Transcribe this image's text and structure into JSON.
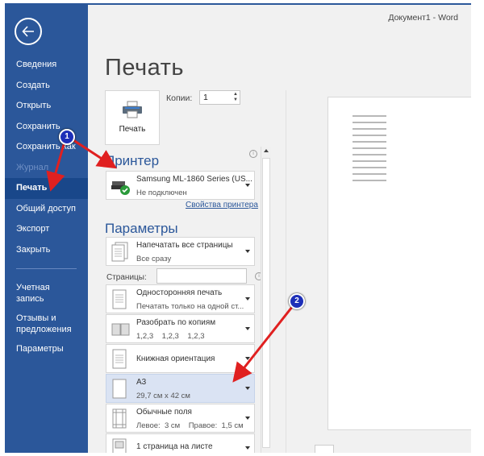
{
  "window": {
    "title": "Документ1  -  Word"
  },
  "colors": {
    "accent": "#2b579a",
    "sidebar_active": "#19478a",
    "selected_row": "#dae3f3",
    "annotation_arrow": "#e02020",
    "annotation_badge": "#1d2fb8"
  },
  "sidebar": {
    "back_icon": "arrow-left-circle-icon",
    "items": [
      {
        "label": "Сведения",
        "state": "normal"
      },
      {
        "label": "Создать",
        "state": "normal"
      },
      {
        "label": "Открыть",
        "state": "normal"
      },
      {
        "label": "Сохранить",
        "state": "normal"
      },
      {
        "label": "Сохранить как",
        "state": "normal"
      },
      {
        "label": "Журнал",
        "state": "disabled"
      },
      {
        "label": "Печать",
        "state": "active"
      },
      {
        "label": "Общий доступ",
        "state": "normal"
      },
      {
        "label": "Экспорт",
        "state": "normal"
      },
      {
        "label": "Закрыть",
        "state": "normal"
      }
    ],
    "bottom_items": [
      {
        "label": "Учетная запись"
      },
      {
        "label": "Отзывы и предложения"
      },
      {
        "label": "Параметры"
      }
    ]
  },
  "main": {
    "title": "Печать",
    "print_button": {
      "label": "Печать",
      "icon": "printer-icon"
    },
    "copies": {
      "label": "Копии:",
      "value": "1"
    },
    "printer": {
      "section_title": "Принтер",
      "name": "Samsung ML-1860 Series (US...",
      "status": "Не подключен",
      "properties_link": "Свойства принтера"
    },
    "settings": {
      "section_title": "Параметры",
      "pages_label": "Страницы:",
      "pages_value": "",
      "options": [
        {
          "line1": "Напечатать все страницы",
          "line2": "Все сразу",
          "icon": "pages-icon"
        },
        {
          "line1": "Односторонняя печать",
          "line2": "Печатать только на одной ст...",
          "icon": "one-sided-icon"
        },
        {
          "line1": "Разобрать по копиям",
          "line2": "1,2,3    1,2,3    1,2,3",
          "icon": "collate-icon"
        },
        {
          "line1": "Книжная ориентация",
          "line2": "",
          "icon": "portrait-icon"
        },
        {
          "line1": "A3",
          "line2": "29,7 см x 42 см",
          "icon": "paper-size-icon",
          "selected": true
        },
        {
          "line1": "Обычные поля",
          "line2": "Левое:  3 см    Правое:  1,5 см",
          "icon": "margins-icon"
        },
        {
          "line1": "1 страница на листе",
          "line2": "",
          "icon": "pages-per-sheet-icon"
        }
      ]
    }
  },
  "annotations": [
    {
      "number": "1"
    },
    {
      "number": "2"
    }
  ]
}
